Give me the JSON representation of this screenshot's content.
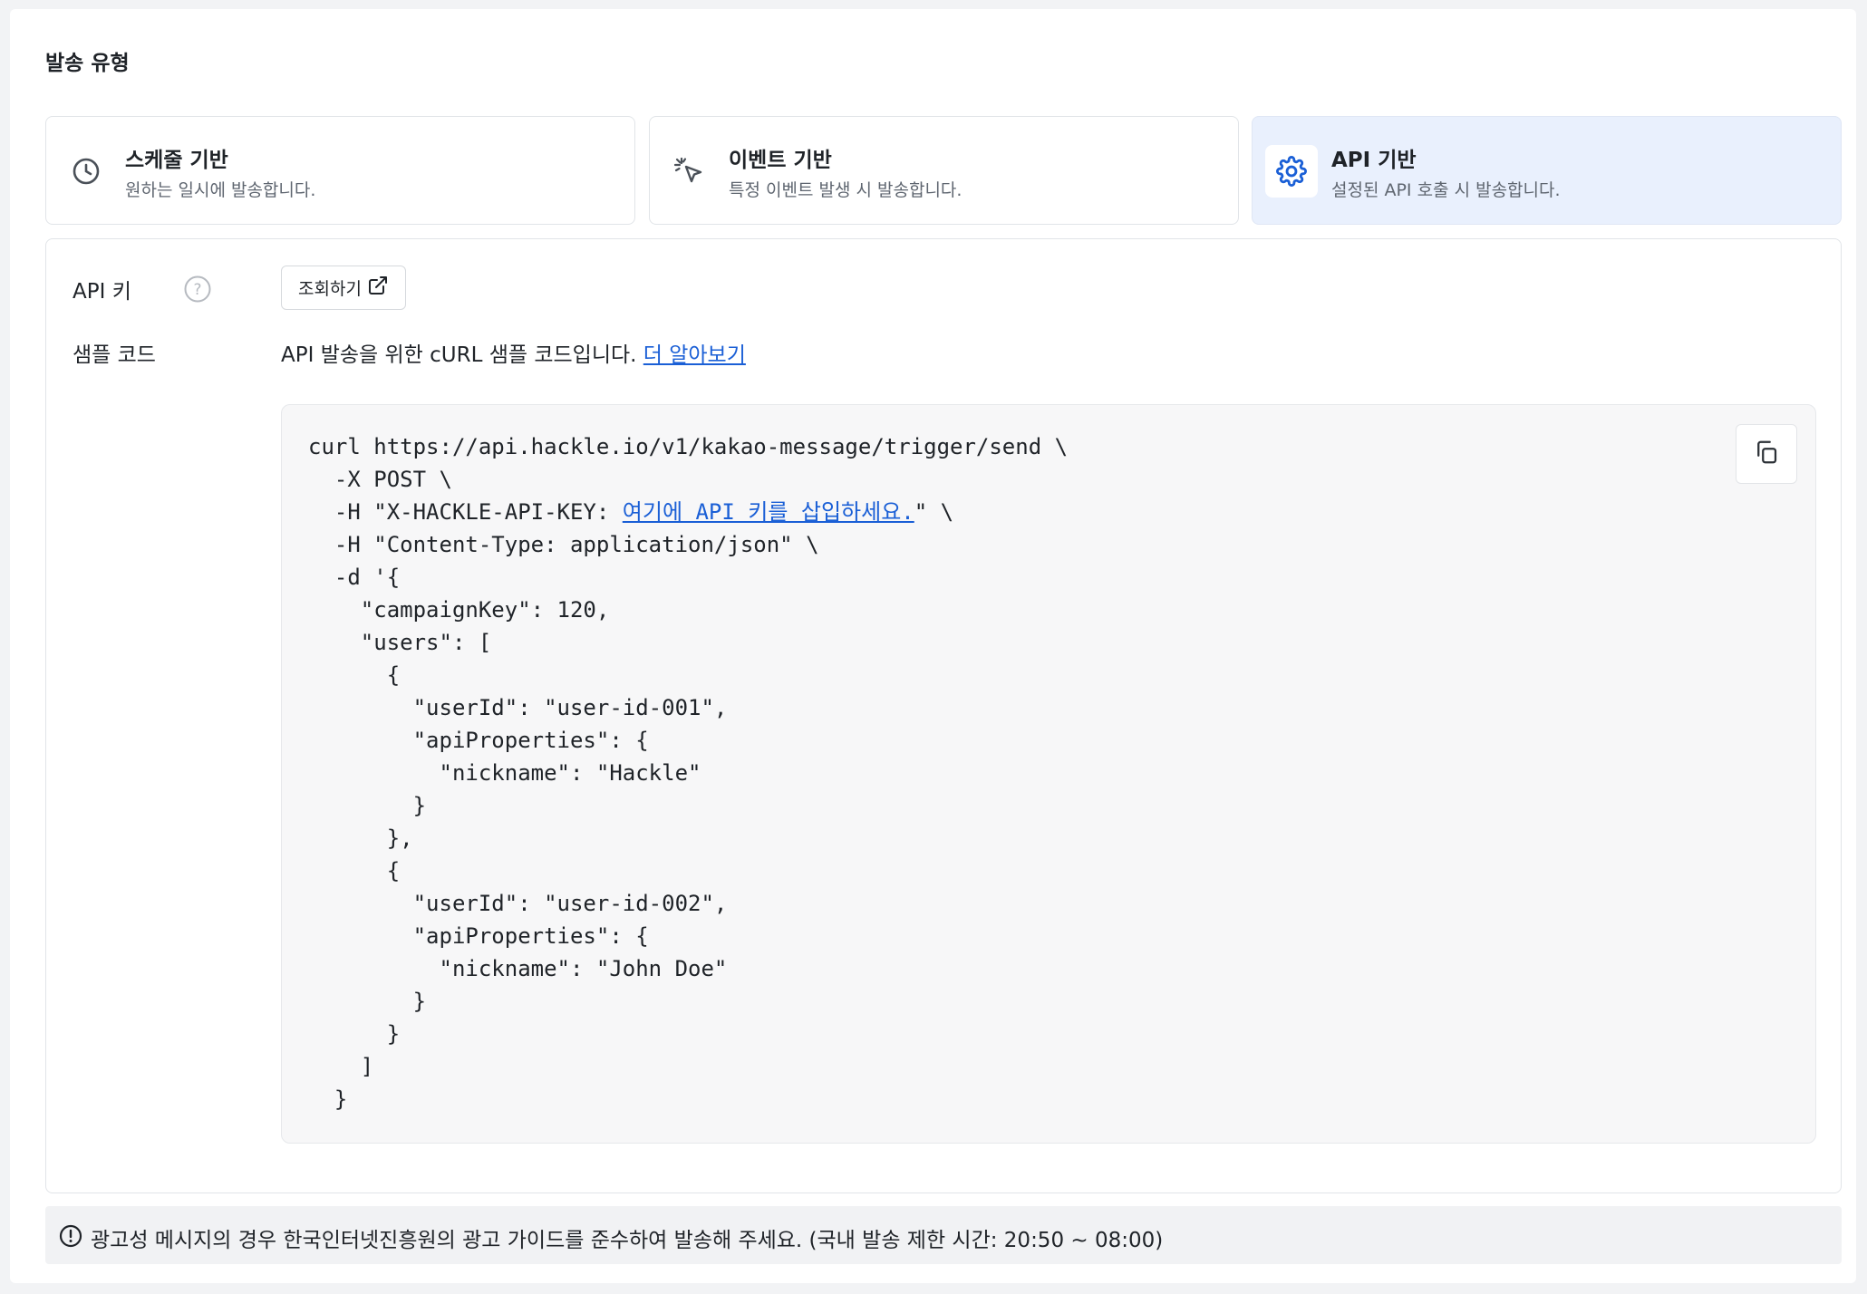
{
  "section": {
    "title": "발송 유형"
  },
  "send_types": [
    {
      "title": "스케줄 기반",
      "desc": "원하는 일시에 발송합니다.",
      "icon": "clock-icon",
      "selected": false
    },
    {
      "title": "이벤트 기반",
      "desc": "특정 이벤트 발생 시 발송합니다.",
      "icon": "cursor-click-icon",
      "selected": false
    },
    {
      "title": "API 기반",
      "desc": "설정된 API 호출 시 발송합니다.",
      "icon": "gear-icon",
      "selected": true
    }
  ],
  "api_key": {
    "label": "API 키",
    "help_icon": "question-circle-icon",
    "button_label": "조회하기",
    "button_icon": "external-link-icon"
  },
  "sample": {
    "label": "샘플 코드",
    "description": "API 발송을 위한 cURL 샘플 코드입니다.",
    "link_label": "더 알아보기",
    "code": {
      "line1": "curl https://api.hackle.io/v1/kakao-message/trigger/send \\",
      "line2": "  -X POST \\",
      "line3_pre": "  -H \"X-HACKLE-API-KEY: ",
      "line3_placeholder": "여기에 API 키를 삽입하세요.",
      "line3_post": "\" \\",
      "rest": "  -H \"Content-Type: application/json\" \\\n  -d '{\n    \"campaignKey\": 120,\n    \"users\": [\n      {\n        \"userId\": \"user-id-001\",\n        \"apiProperties\": {\n          \"nickname\": \"Hackle\"\n        }\n      },\n      {\n        \"userId\": \"user-id-002\",\n        \"apiProperties\": {\n          \"nickname\": \"John Doe\"\n        }\n      }\n    ]\n  }"
    },
    "copy_icon": "copy-icon"
  },
  "notice": {
    "icon": "alert-circle-icon",
    "text": "광고성 메시지의 경우 한국인터넷진흥원의 광고 가이드를 준수하여 발송해 주세요. (국내 발송 제한 시간: 20:50 ~ 08:00)"
  },
  "colors": {
    "accent": "#1a5fd6",
    "selected_bg": "#e9f0fd",
    "code_bg": "#f7f7f8"
  }
}
